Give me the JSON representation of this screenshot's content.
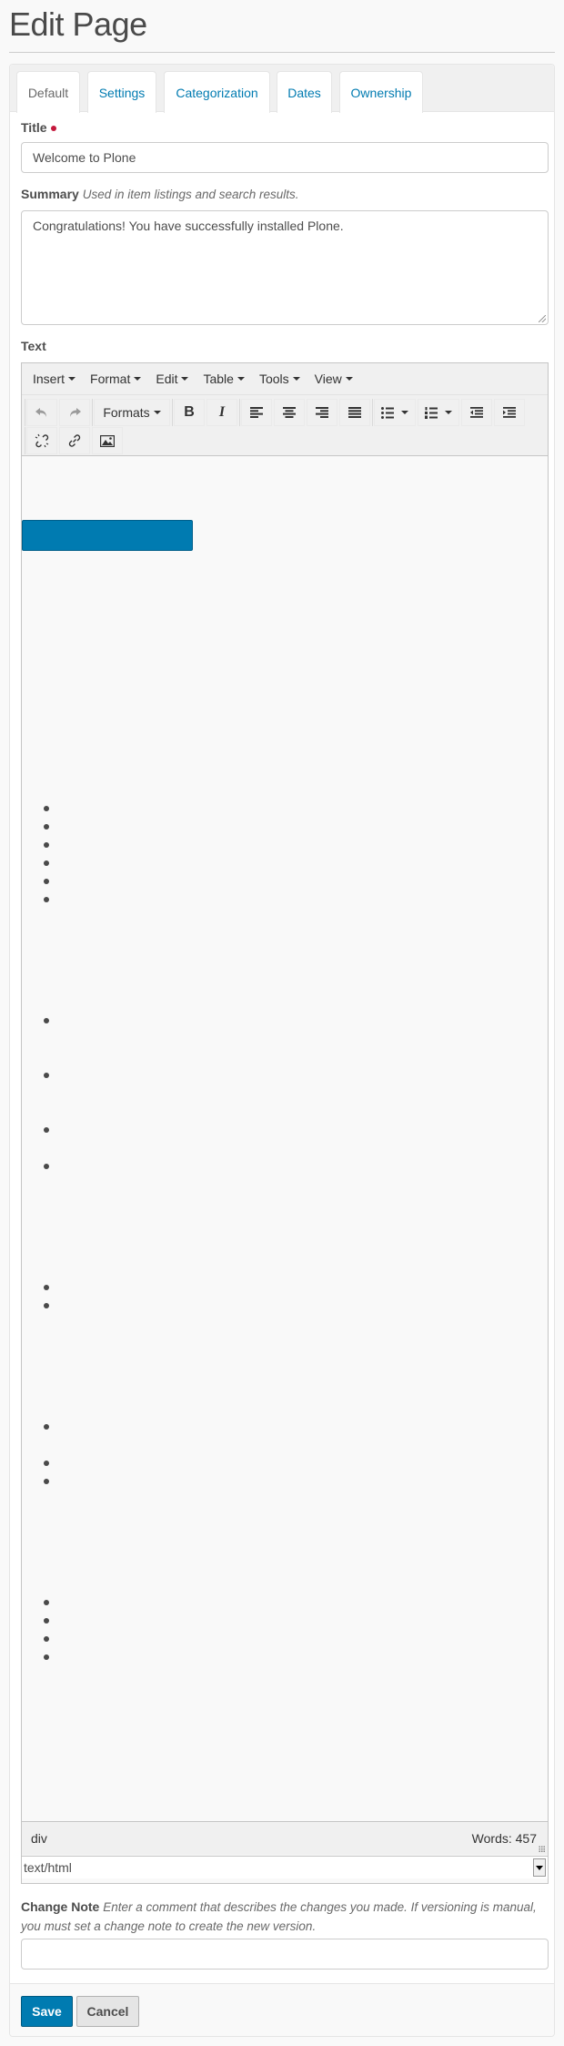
{
  "page": {
    "title": "Edit Page"
  },
  "tabs": [
    {
      "label": "Default",
      "active": true
    },
    {
      "label": "Settings",
      "active": false
    },
    {
      "label": "Categorization",
      "active": false
    },
    {
      "label": "Dates",
      "active": false
    },
    {
      "label": "Ownership",
      "active": false
    }
  ],
  "fields": {
    "title": {
      "label": "Title",
      "required": true,
      "value": "Welcome to Plone"
    },
    "summary": {
      "label": "Summary",
      "help": "Used in item listings and search results.",
      "value": "Congratulations! You have successfully installed Plone."
    },
    "text": {
      "label": "Text"
    },
    "change_note": {
      "label": "Change Note",
      "help": "Enter a comment that describes the changes you made. If versioning is manual, you must set a change note to create the new version.",
      "value": ""
    }
  },
  "editor": {
    "menubar": [
      "Insert",
      "Format",
      "Edit",
      "Table",
      "Tools",
      "View"
    ],
    "toolbar": {
      "formats_label": "Formats",
      "buttons": [
        "undo",
        "redo",
        "formats",
        "bold",
        "italic",
        "align-left",
        "align-center",
        "align-right",
        "align-justify",
        "bullet-list",
        "numbered-list",
        "outdent",
        "indent",
        "unlink",
        "link",
        "image"
      ]
    },
    "content": {
      "bullet_count": 19
    },
    "statusbar": {
      "path": "div",
      "word_count": "Words: 457"
    },
    "mime_type": "text/html"
  },
  "buttons": {
    "save": "Save",
    "cancel": "Cancel"
  },
  "colors": {
    "accent": "#007bb1",
    "required": "#c4183c"
  }
}
